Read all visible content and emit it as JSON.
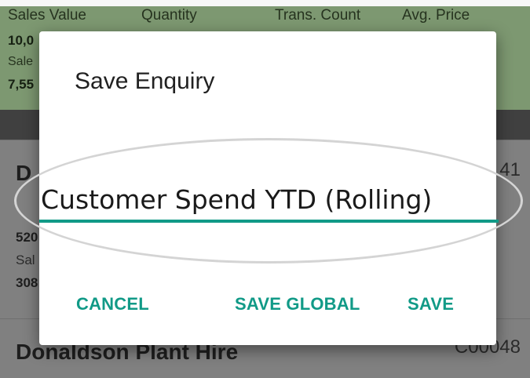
{
  "summary": {
    "headers": [
      "Sales Value",
      "Quantity",
      "Trans. Count",
      "Avg. Price"
    ],
    "value1": "10,0",
    "label": "Sale",
    "value2": "7,55"
  },
  "list": {
    "items": [
      {
        "name": "D",
        "code": "41",
        "num": "520",
        "sub": "Sal",
        "num2": "308"
      },
      {
        "name": "Donaldson Plant Hire",
        "code": "C00048"
      }
    ]
  },
  "dialog": {
    "title": "Save Enquiry",
    "input_value": "Customer Spend YTD (Rolling)",
    "buttons": {
      "cancel": "CANCEL",
      "save_global": "SAVE GLOBAL",
      "save": "SAVE"
    }
  },
  "colors": {
    "accent": "#119a87",
    "summary_bg": "#7d9871"
  }
}
